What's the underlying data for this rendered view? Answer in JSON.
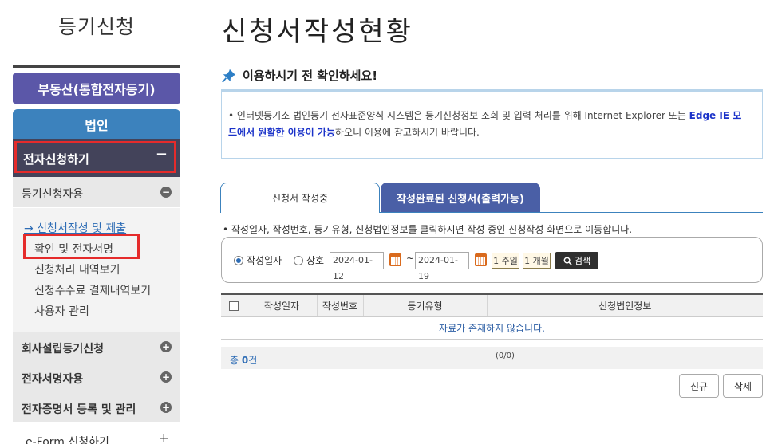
{
  "sidebar": {
    "title": "등기신청",
    "realestate_btn": "부동산(통합전자등기)",
    "corp_btn": "법인",
    "esubmit": {
      "label": "전자신청하기",
      "toggle": "−"
    },
    "groups": [
      {
        "label": "등기신청자용",
        "toggle": "−"
      },
      {
        "label": "회사설립등기신청",
        "toggle": "+"
      },
      {
        "label": "전자서명자용",
        "toggle": "+"
      },
      {
        "label": "전자증명서 등록 및 관리",
        "toggle": "+"
      }
    ],
    "sub_items": [
      "→ 신청서작성 및 제출",
      "확인 및 전자서명",
      "신청처리 내역보기",
      "신청수수료 결제내역보기",
      "사용자 관리"
    ],
    "eform": {
      "label": "e-Form 신청하기",
      "toggle": "+"
    }
  },
  "main": {
    "title": "신청서작성현황",
    "notice_heading": "이용하시기 전 확인하세요!",
    "notice_bullet": "•",
    "notice_text_1": "인터넷등기소 법인등기 전자표준양식 시스템은 등기신청정보 조회 및 입력 처리를 위해 Internet Explorer 또는",
    "notice_highlight": "Edge IE 모드에서 원활한 이용이 가능",
    "notice_text_2": "하오니 이용에 참고하시기 바랍니다.",
    "tabs": [
      {
        "label": "신청서 작성중",
        "active": true
      },
      {
        "label": "작성완료된 신청서(출력가능)",
        "active": false
      }
    ],
    "hint": "• 작성일자, 작성번호, 등기유형, 신청법인정보를 클릭하시면 작성 중인 신청작성 화면으로 이동합니다.",
    "filter": {
      "radio_date": "작성일자",
      "radio_name": "상호",
      "date_from": "2024-01-12",
      "tilde": "~",
      "date_to": "2024-01-19",
      "week_btn": "1 주일",
      "month_btn": "1 개월",
      "search_btn": "검색"
    },
    "table": {
      "headers": [
        "작성일자",
        "작성번호",
        "등기유형",
        "신청법인정보"
      ],
      "empty_msg": "자료가 존재하지 않습니다."
    },
    "total": {
      "prefix": "총 ",
      "count": "0",
      "suffix": "건",
      "pager": "(0/0)"
    },
    "actions": {
      "new": "신규",
      "delete": "삭제"
    }
  },
  "colors": {
    "realestate_btn": "#5b57a8",
    "corp_btn": "#3c82bd",
    "esubmit_bg": "#43435a",
    "highlight_text": "#1a32c9",
    "annotation_red": "#e52b2b",
    "active_tab_bg": "#4a5fa6"
  },
  "icons": [
    "pushpin-icon",
    "calendar-icon",
    "search-icon",
    "minus-icon",
    "plus-icon"
  ]
}
